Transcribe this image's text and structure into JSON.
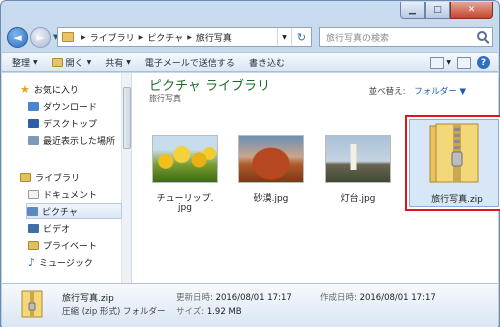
{
  "window": {
    "caption_buttons": {
      "minimize": "▁",
      "maximize": "□",
      "close": "✕"
    }
  },
  "nav": {
    "back_icon": "back-arrow-icon",
    "forward_icon": "forward-arrow-icon",
    "breadcrumb": [
      "ライブラリ",
      "ピクチャ",
      "旅行写真"
    ],
    "search_placeholder": "旅行写真の検索"
  },
  "toolbar": {
    "organize": "整理",
    "open": "開く",
    "share": "共有",
    "email": "電子メールで送信する",
    "burn": "書き込む"
  },
  "sidebar": {
    "favorites": {
      "label": "お気に入り",
      "items": [
        "ダウンロード",
        "デスクトップ",
        "最近表示した場所"
      ]
    },
    "libraries": {
      "label": "ライブラリ",
      "items": [
        "ドキュメント",
        "ピクチャ",
        "ビデオ",
        "プライベート",
        "ミュージック"
      ],
      "selected": "ピクチャ"
    }
  },
  "main": {
    "title": "ピクチャ ライブラリ",
    "subtitle": "旅行写真",
    "arrange_label": "並べ替え:",
    "arrange_value": "フォルダー",
    "files": [
      {
        "name": "チューリップ.",
        "name2": "jpg"
      },
      {
        "name": "砂漠.jpg"
      },
      {
        "name": "灯台.jpg"
      },
      {
        "name": "旅行写真.zip",
        "selected": true
      }
    ]
  },
  "details": {
    "name": "旅行写真.zip",
    "type": "圧縮 (zip 形式) フォルダー",
    "modified_label": "更新日時:",
    "modified_value": "2016/08/01 17:17",
    "size_label": "サイズ:",
    "size_value": "1.92 MB",
    "created_label": "作成日時:",
    "created_value": "2016/08/01 17:17"
  },
  "colors": {
    "accent": "#2f6fc2",
    "library_title": "#1a6c2a",
    "highlight_border": "#e0151b"
  }
}
